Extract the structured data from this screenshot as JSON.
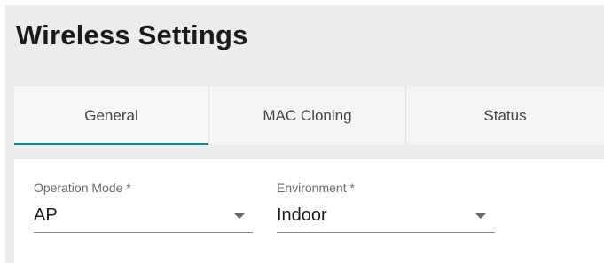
{
  "page": {
    "title": "Wireless Settings"
  },
  "tabs": [
    {
      "label": "General",
      "active": true
    },
    {
      "label": "MAC Cloning",
      "active": false
    },
    {
      "label": "Status",
      "active": false
    }
  ],
  "form": {
    "operation_mode": {
      "label": "Operation Mode *",
      "value": "AP"
    },
    "environment": {
      "label": "Environment *",
      "value": "Indoor"
    }
  },
  "colors": {
    "accent": "#1a8a8a"
  },
  "icons": {
    "dropdown": "chevron-down-icon"
  }
}
